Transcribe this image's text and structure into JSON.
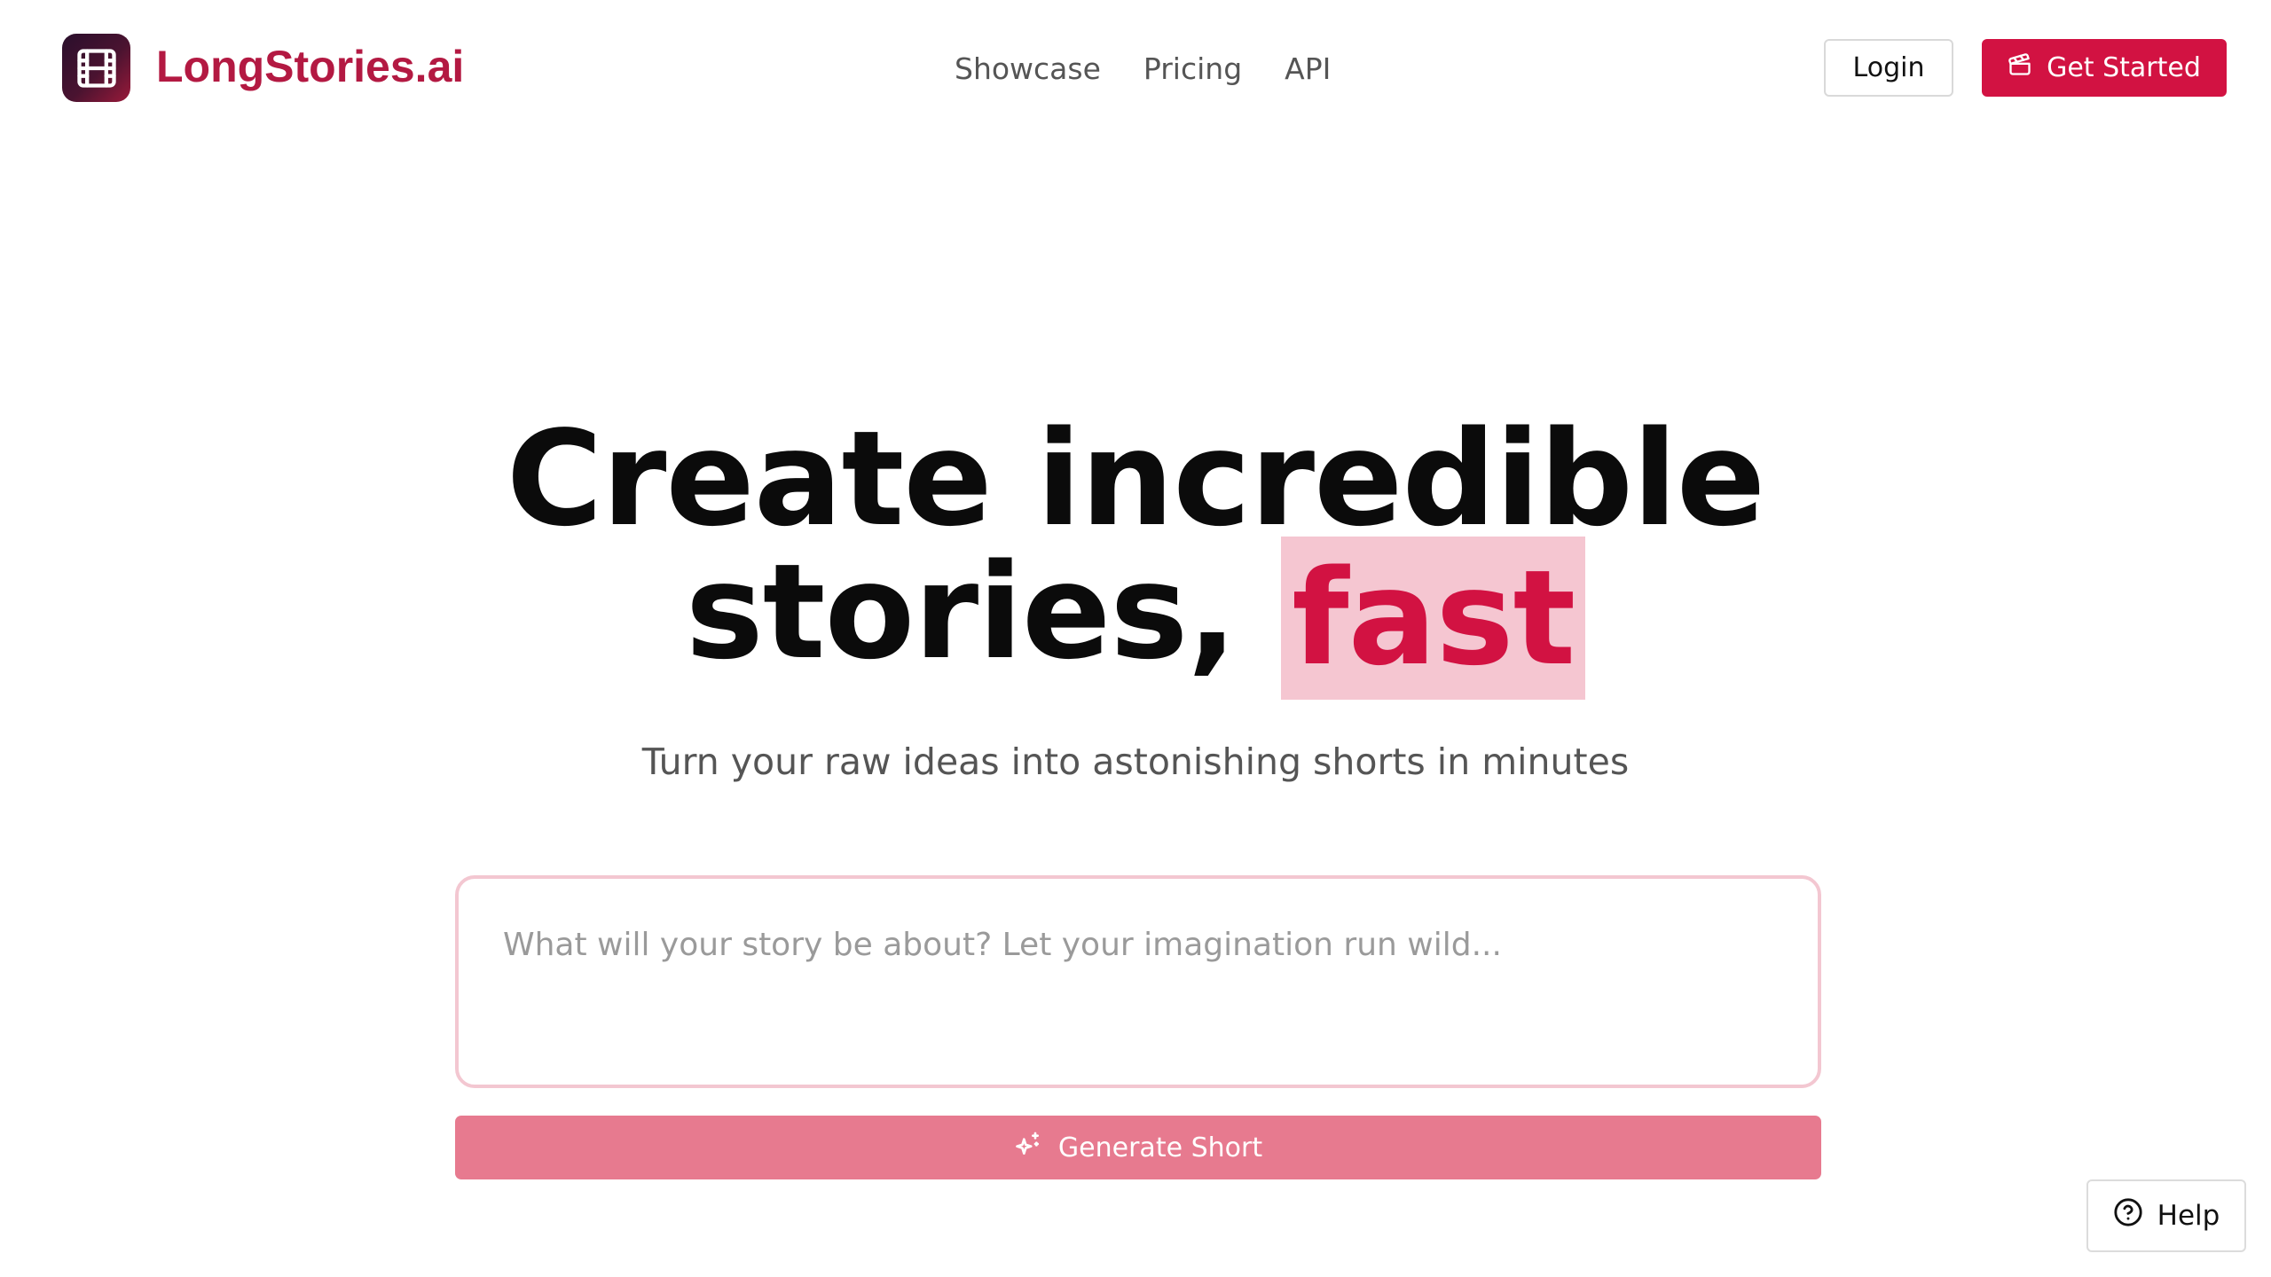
{
  "brand": {
    "name": "LongStories.ai",
    "icon": "film-icon",
    "color": "#b31942"
  },
  "nav": {
    "items": [
      "Showcase",
      "Pricing",
      "API"
    ]
  },
  "header": {
    "login_label": "Login",
    "get_started_label": "Get Started",
    "get_started_icon": "clapperboard-icon",
    "accent": "#d21242"
  },
  "hero": {
    "title_line1": "Create incredible",
    "title_line2_prefix": "stories,",
    "title_highlight": "fast",
    "subtitle": "Turn your raw ideas into astonishing shorts in minutes"
  },
  "prompt": {
    "placeholder": "What will your story be about? Let your imagination run wild...",
    "value": ""
  },
  "generate": {
    "label": "Generate Short",
    "icon": "sparkles-icon",
    "color": "#e77a8f"
  },
  "help": {
    "label": "Help",
    "icon": "question-circle-icon"
  }
}
